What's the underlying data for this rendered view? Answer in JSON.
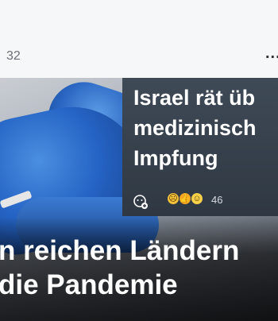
{
  "top_post": {
    "count": "32",
    "more_label": "..."
  },
  "hero": {
    "title": "n reichen Ländern\n die Pandemie"
  },
  "overlay_card": {
    "title": "Israel rät üb\nmedizinisch\nImpfung",
    "reaction_count": "46",
    "reactions": [
      "emoji-1",
      "emoji-2",
      "emoji-3"
    ]
  },
  "colors": {
    "overlay_bg": "#333c47",
    "text_white": "#ffffff",
    "count_gray": "#6b6f75"
  }
}
